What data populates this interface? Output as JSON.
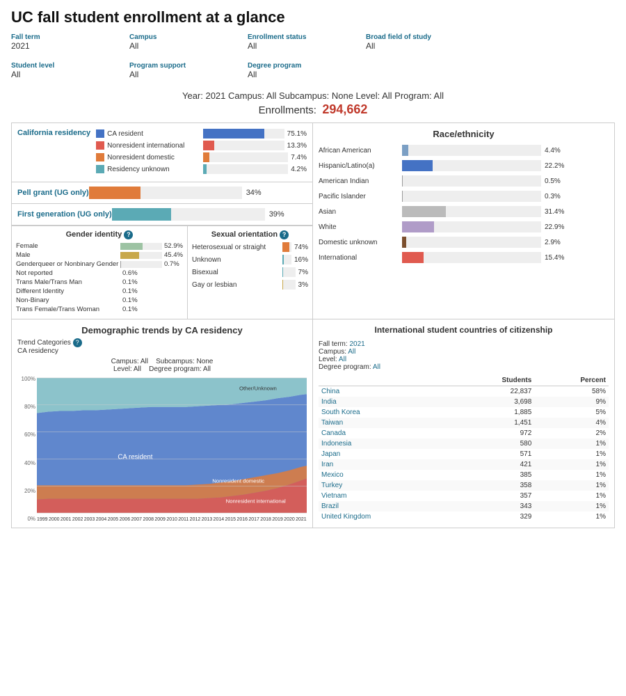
{
  "title": "UC fall student enrollment at a glance",
  "filters": [
    {
      "label": "Fall term",
      "value": "2021"
    },
    {
      "label": "Campus",
      "value": "All"
    },
    {
      "label": "Enrollment status",
      "value": "All"
    },
    {
      "label": "Broad field of study",
      "value": "All"
    },
    {
      "label": "Student level",
      "value": "All"
    },
    {
      "label": "Program support",
      "value": "All"
    },
    {
      "label": "Degree program",
      "value": "All"
    }
  ],
  "subtitle": "Year: 2021  Campus: All   Subcampus: None  Level: All   Program: All",
  "enrollments_label": "Enrollments:",
  "enrollments_value": "294,662",
  "residency": {
    "label": "California residency",
    "bars": [
      {
        "name": "CA resident",
        "pct": "75.1%",
        "value": 75.1,
        "color": "#4472c4"
      },
      {
        "name": "Nonresident international",
        "pct": "13.3%",
        "value": 13.3,
        "color": "#e05a4f"
      },
      {
        "name": "Nonresident domestic",
        "pct": "7.4%",
        "value": 7.4,
        "color": "#e07b3a"
      },
      {
        "name": "Residency unknown",
        "pct": "4.2%",
        "value": 4.2,
        "color": "#5baab5"
      }
    ]
  },
  "pell_grant": {
    "label": "Pell grant (UG only)",
    "pct": "34%",
    "value": 34,
    "color": "#e07b3a"
  },
  "first_gen": {
    "label": "First generation (UG only)",
    "pct": "39%",
    "value": 39,
    "color": "#5baab5"
  },
  "gender": {
    "title": "Gender identity",
    "rows": [
      {
        "name": "Female",
        "pct": "52.9%",
        "value": 52.9,
        "color": "#9dc3a3"
      },
      {
        "name": "Male",
        "pct": "45.4%",
        "value": 45.4,
        "color": "#c8a84b"
      },
      {
        "name": "Genderqueer or Nonbinary Gender",
        "pct": "0.7%",
        "value": 0.7,
        "color": "#7b9fc4"
      },
      {
        "name": "Not reported",
        "pct": "0.6%",
        "value": 0.6,
        "color": "#999"
      },
      {
        "name": "Trans Male/Trans Man",
        "pct": "0.1%",
        "value": 0.1,
        "color": "#999"
      },
      {
        "name": "Different Identity",
        "pct": "0.1%",
        "value": 0.1,
        "color": "#999"
      },
      {
        "name": "Non-Binary",
        "pct": "0.1%",
        "value": 0.1,
        "color": "#999"
      },
      {
        "name": "Trans Female/Trans Woman",
        "pct": "0.1%",
        "value": 0.1,
        "color": "#999"
      }
    ]
  },
  "sexual": {
    "title": "Sexual orientation",
    "rows": [
      {
        "name": "Heterosexual or straight",
        "pct": "74%",
        "value": 74,
        "color": "#e07b3a"
      },
      {
        "name": "Unknown",
        "pct": "16%",
        "value": 16,
        "color": "#5baab5"
      },
      {
        "name": "Bisexual",
        "pct": "7%",
        "value": 7,
        "color": "#5baab5"
      },
      {
        "name": "Gay or lesbian",
        "pct": "3%",
        "value": 3,
        "color": "#c8a84b"
      }
    ]
  },
  "race": {
    "title": "Race/ethnicity",
    "rows": [
      {
        "name": "African American",
        "pct": "4.4%",
        "value": 4.4,
        "color": "#7b9fc4"
      },
      {
        "name": "Hispanic/Latino(a)",
        "pct": "22.2%",
        "value": 22.2,
        "color": "#4472c4"
      },
      {
        "name": "American Indian",
        "pct": "0.5%",
        "value": 0.5,
        "color": "#999"
      },
      {
        "name": "Pacific Islander",
        "pct": "0.3%",
        "value": 0.3,
        "color": "#999"
      },
      {
        "name": "Asian",
        "pct": "31.4%",
        "value": 31.4,
        "color": "#bbb"
      },
      {
        "name": "White",
        "pct": "22.9%",
        "value": 22.9,
        "color": "#b09cc8"
      },
      {
        "name": "Domestic unknown",
        "pct": "2.9%",
        "value": 2.9,
        "color": "#7b4f2e"
      },
      {
        "name": "International",
        "pct": "15.4%",
        "value": 15.4,
        "color": "#e05a4f"
      }
    ]
  },
  "trend": {
    "title": "Demographic trends by CA residency",
    "trend_categories_label": "Trend Categories",
    "trend_category_value": "CA residency",
    "campus": "All",
    "subcampus": "None",
    "level": "All",
    "degree_program": "All",
    "chart": {
      "y_labels": [
        "100%",
        "80%",
        "60%",
        "40%",
        "20%",
        "0%"
      ],
      "x_labels": [
        "1999",
        "2000",
        "2001",
        "2002",
        "2003",
        "2004",
        "2005",
        "2006",
        "2007",
        "2008",
        "2009",
        "2010",
        "2011",
        "2012",
        "2013",
        "2014",
        "2015",
        "2016",
        "2017",
        "2018",
        "2019",
        "2020",
        "2021"
      ],
      "legend": [
        {
          "label": "CA resident",
          "color": "#4472c4"
        },
        {
          "label": "Nonresident domestic",
          "color": "#e07b3a"
        },
        {
          "label": "Nonresident international",
          "color": "#e05a4f"
        },
        {
          "label": "Other/Unknown",
          "color": "#5baab5"
        }
      ]
    }
  },
  "intl": {
    "title": "International student countries of citizenship",
    "filters": {
      "fall_term": "2021",
      "campus": "All",
      "level": "All",
      "degree_program": "All"
    },
    "table_headers": [
      "",
      "Students",
      "Percent"
    ],
    "rows": [
      {
        "country": "China",
        "students": "22,837",
        "percent": "58%"
      },
      {
        "country": "India",
        "students": "3,698",
        "percent": "9%"
      },
      {
        "country": "South Korea",
        "students": "1,885",
        "percent": "5%"
      },
      {
        "country": "Taiwan",
        "students": "1,451",
        "percent": "4%"
      },
      {
        "country": "Canada",
        "students": "972",
        "percent": "2%"
      },
      {
        "country": "Indonesia",
        "students": "580",
        "percent": "1%"
      },
      {
        "country": "Japan",
        "students": "571",
        "percent": "1%"
      },
      {
        "country": "Iran",
        "students": "421",
        "percent": "1%"
      },
      {
        "country": "Mexico",
        "students": "385",
        "percent": "1%"
      },
      {
        "country": "Turkey",
        "students": "358",
        "percent": "1%"
      },
      {
        "country": "Vietnam",
        "students": "357",
        "percent": "1%"
      },
      {
        "country": "Brazil",
        "students": "343",
        "percent": "1%"
      },
      {
        "country": "United Kingdom",
        "students": "329",
        "percent": "1%"
      }
    ]
  }
}
